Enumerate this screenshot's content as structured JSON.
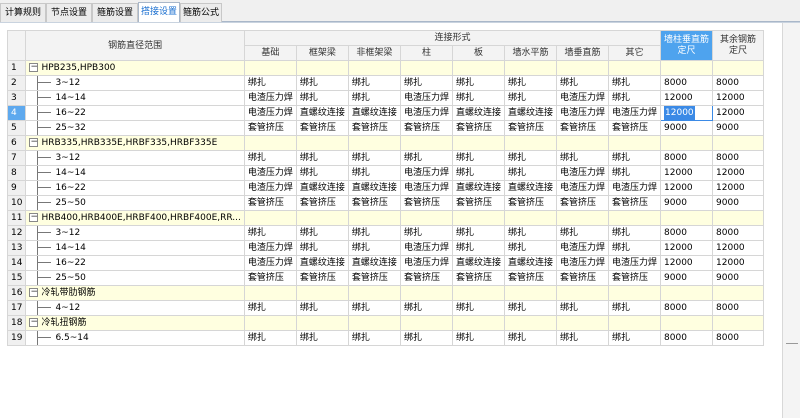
{
  "tabs": [
    {
      "label": "计算规则",
      "active": false
    },
    {
      "label": "节点设置",
      "active": false
    },
    {
      "label": "箍筋设置",
      "active": false
    },
    {
      "label": "搭接设置",
      "active": true
    },
    {
      "label": "箍筋公式",
      "active": false
    }
  ],
  "header": {
    "range_label": "钢筋直径范围",
    "group_label": "连接形式",
    "sub_columns": [
      "基础",
      "框架梁",
      "非框架梁",
      "柱",
      "板",
      "墙水平筋",
      "墙垂直筋",
      "其它"
    ],
    "col_wall_col_length": "墙柱垂直筋定尺",
    "col_other_length": "其余钢筋定尺"
  },
  "rows": [
    {
      "num": "1",
      "type": "cat",
      "name": "HPB235,HPB300"
    },
    {
      "num": "2",
      "type": "item",
      "name": "3~12",
      "cells": [
        "绑扎",
        "绑扎",
        "绑扎",
        "绑扎",
        "绑扎",
        "绑扎",
        "绑扎",
        "绑扎",
        "8000",
        "8000"
      ]
    },
    {
      "num": "3",
      "type": "item",
      "name": "14~14",
      "cells": [
        "电渣压力焊",
        "绑扎",
        "绑扎",
        "电渣压力焊",
        "绑扎",
        "绑扎",
        "电渣压力焊",
        "绑扎",
        "12000",
        "12000"
      ]
    },
    {
      "num": "4",
      "type": "item",
      "name": "16~22",
      "current": true,
      "cells": [
        "电渣压力焊",
        "直螺纹连接",
        "直螺纹连接",
        "电渣压力焊",
        "直螺纹连接",
        "直螺纹连接",
        "电渣压力焊",
        "电渣压力焊",
        "12000",
        "12000"
      ]
    },
    {
      "num": "5",
      "type": "item",
      "name": "25~32",
      "cells": [
        "套管挤压",
        "套管挤压",
        "套管挤压",
        "套管挤压",
        "套管挤压",
        "套管挤压",
        "套管挤压",
        "套管挤压",
        "9000",
        "9000"
      ]
    },
    {
      "num": "6",
      "type": "cat",
      "name": "HRB335,HRB335E,HRBF335,HRBF335E"
    },
    {
      "num": "7",
      "type": "item",
      "name": "3~12",
      "cells": [
        "绑扎",
        "绑扎",
        "绑扎",
        "绑扎",
        "绑扎",
        "绑扎",
        "绑扎",
        "绑扎",
        "8000",
        "8000"
      ]
    },
    {
      "num": "8",
      "type": "item",
      "name": "14~14",
      "cells": [
        "电渣压力焊",
        "绑扎",
        "绑扎",
        "电渣压力焊",
        "绑扎",
        "绑扎",
        "电渣压力焊",
        "绑扎",
        "12000",
        "12000"
      ]
    },
    {
      "num": "9",
      "type": "item",
      "name": "16~22",
      "cells": [
        "电渣压力焊",
        "直螺纹连接",
        "直螺纹连接",
        "电渣压力焊",
        "直螺纹连接",
        "直螺纹连接",
        "电渣压力焊",
        "电渣压力焊",
        "12000",
        "12000"
      ]
    },
    {
      "num": "10",
      "type": "item",
      "name": "25~50",
      "cells": [
        "套管挤压",
        "套管挤压",
        "套管挤压",
        "套管挤压",
        "套管挤压",
        "套管挤压",
        "套管挤压",
        "套管挤压",
        "9000",
        "9000"
      ]
    },
    {
      "num": "11",
      "type": "cat",
      "name": "HRB400,HRB400E,HRBF400,HRBF400E,RR..."
    },
    {
      "num": "12",
      "type": "item",
      "name": "3~12",
      "cells": [
        "绑扎",
        "绑扎",
        "绑扎",
        "绑扎",
        "绑扎",
        "绑扎",
        "绑扎",
        "绑扎",
        "8000",
        "8000"
      ]
    },
    {
      "num": "13",
      "type": "item",
      "name": "14~14",
      "cells": [
        "电渣压力焊",
        "绑扎",
        "绑扎",
        "电渣压力焊",
        "绑扎",
        "绑扎",
        "电渣压力焊",
        "绑扎",
        "12000",
        "12000"
      ]
    },
    {
      "num": "14",
      "type": "item",
      "name": "16~22",
      "cells": [
        "电渣压力焊",
        "直螺纹连接",
        "直螺纹连接",
        "电渣压力焊",
        "直螺纹连接",
        "直螺纹连接",
        "电渣压力焊",
        "电渣压力焊",
        "12000",
        "12000"
      ]
    },
    {
      "num": "15",
      "type": "item",
      "name": "25~50",
      "cells": [
        "套管挤压",
        "套管挤压",
        "套管挤压",
        "套管挤压",
        "套管挤压",
        "套管挤压",
        "套管挤压",
        "套管挤压",
        "9000",
        "9000"
      ]
    },
    {
      "num": "16",
      "type": "cat",
      "name": "冷轧带肋钢筋"
    },
    {
      "num": "17",
      "type": "item",
      "name": "4~12",
      "cells": [
        "绑扎",
        "绑扎",
        "绑扎",
        "绑扎",
        "绑扎",
        "绑扎",
        "绑扎",
        "绑扎",
        "8000",
        "8000"
      ]
    },
    {
      "num": "18",
      "type": "cat",
      "name": "冷轧扭钢筋"
    },
    {
      "num": "19",
      "type": "item",
      "name": "6.5~14",
      "cells": [
        "绑扎",
        "绑扎",
        "绑扎",
        "绑扎",
        "绑扎",
        "绑扎",
        "绑扎",
        "绑扎",
        "8000",
        "8000"
      ]
    }
  ],
  "toggle_symbol": "−",
  "colors": {
    "accent": "#4ea3ee",
    "category_bg": "#ffffe0",
    "active_tab_text": "#1a6fd0"
  }
}
